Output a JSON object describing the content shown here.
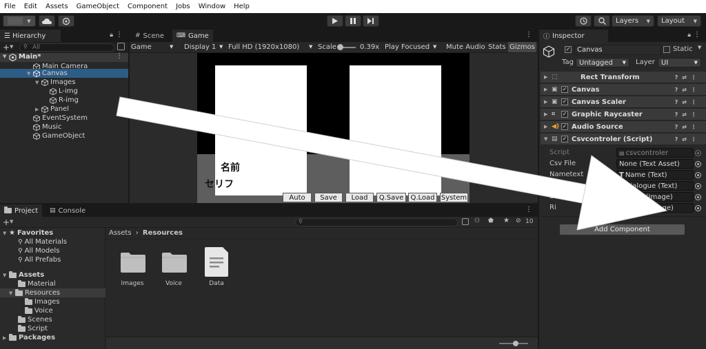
{
  "menu": [
    "File",
    "Edit",
    "Assets",
    "GameObject",
    "Component",
    "Jobs",
    "Window",
    "Help"
  ],
  "toolbar": {
    "layers_label": "Layers",
    "layout_label": "Layout"
  },
  "hierarchy": {
    "tab_label": "Hierarchy",
    "search_placeholder": "All",
    "scene_name": "Main*",
    "items": [
      "Main Camera",
      "Canvas",
      "Images",
      "L-img",
      "R-img",
      "Panel",
      "EventSystem",
      "Music",
      "GameObject"
    ]
  },
  "view_tabs": {
    "scene": "Scene",
    "game": "Game"
  },
  "game_toolbar": {
    "mode": "Game",
    "display": "Display 1",
    "resolution": "Full HD (1920x1080)",
    "scale_label": "Scale",
    "scale_value": "0.39x",
    "play_focused": "Play Focused",
    "mute_audio": "Mute Audio",
    "stats": "Stats",
    "gizmos": "Gizmos"
  },
  "game_view": {
    "name_text": "名前",
    "dialogue_text": "セリフ",
    "buttons": [
      "Auto",
      "Save",
      "Load",
      "Q.Save",
      "Q.Load",
      "System"
    ]
  },
  "project": {
    "tab_label": "Project",
    "console_label": "Console",
    "hidden_count": "10",
    "favorites_label": "Favorites",
    "favorites": [
      "All Materials",
      "All Models",
      "All Prefabs"
    ],
    "assets_label": "Assets",
    "assets_tree": [
      "Material",
      "Resources",
      "Images",
      "Voice",
      "Scenes",
      "Script"
    ],
    "packages_label": "Packages",
    "breadcrumb": [
      "Assets",
      "Resources"
    ],
    "grid_items": [
      {
        "label": "Images",
        "icon": "folder-icon"
      },
      {
        "label": "Voice",
        "icon": "folder-icon"
      },
      {
        "label": "Data",
        "icon": "document-icon"
      }
    ]
  },
  "inspector": {
    "tab_label": "Inspector",
    "object_name": "Canvas",
    "static_label": "Static",
    "tag_label": "Tag",
    "tag_value": "Untagged",
    "layer_label": "Layer",
    "layer_value": "UI",
    "components": [
      "Rect Transform",
      "Canvas",
      "Canvas Scaler",
      "Graphic Raycaster",
      "Audio Source",
      "Csvcontroler (Script)"
    ],
    "script_fields": [
      {
        "label": "Script",
        "value": "csvcontroler"
      },
      {
        "label": "Csv File",
        "value": "None (Text Asset)"
      },
      {
        "label": "Nametext",
        "value": "Name (Text)"
      },
      {
        "label": "Log",
        "value": "Dialogue (Text)"
      },
      {
        "label": "Le",
        "value": "L-img (Image)"
      },
      {
        "label": "Ri",
        "value": "R-img (Image)"
      }
    ],
    "add_component": "Add Component"
  },
  "colors": {
    "selection": "#2c5d87",
    "arrow": "#ffffff",
    "panel": "#282828"
  }
}
